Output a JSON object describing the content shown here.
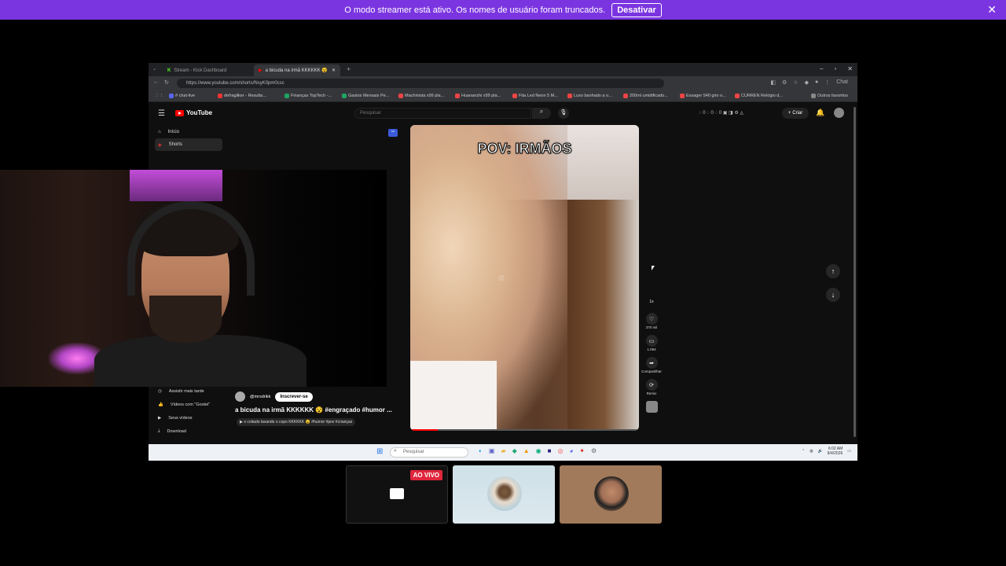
{
  "banner": {
    "message": "O modo streamer está ativo. Os nomes de usuário foram truncados.",
    "button_label": "Desativar",
    "bg_color": "#7b35e0"
  },
  "browser": {
    "tabs": [
      {
        "label": "Stream - Kick Dashboard"
      },
      {
        "label": "a bicuda na irmã KKKKKK 😵"
      }
    ],
    "url": "https://www.youtube.com/shorts/NsyK0pm0csc",
    "bookmarks": [
      "# chat-live",
      "defragliker - Resulta...",
      "Finanças TopTech -...",
      "Gastos Mensais Pe...",
      "Machinista x99 pla...",
      "Huananzhi x99 pla...",
      "Fita Led Neon 5 M...",
      "Luxo banhado a o...",
      "200ml umidificado...",
      "Essager 540 giro o...",
      "CURREN Relógio d...",
      "Outros favoritos"
    ],
    "chat_label": "Chat"
  },
  "youtube": {
    "logo_text": "YouTube",
    "search_placeholder": "Pesquisar",
    "create_label": "Criar",
    "sidebar_top": [
      {
        "icon": "home-icon",
        "label": "Início"
      },
      {
        "icon": "shorts-icon",
        "label": "Shorts"
      }
    ],
    "sidebar_bottom": [
      {
        "icon": "clock-icon",
        "label": "Assistir mais tarde"
      },
      {
        "icon": "like-icon",
        "label": "Vídeos com \"Gostei\""
      },
      {
        "icon": "video-icon",
        "label": "Seus vídeos"
      },
      {
        "icon": "download-icon",
        "label": "Download"
      }
    ],
    "short": {
      "caption": "POV: IRMÃOS",
      "channel": "@mrsdrikk",
      "subscribe_label": "Inscrever-se",
      "title": "a bicuda na irmã KKKKKK 😵 #engraçado #humor ...",
      "description": "▶ o coitado lavando o copo KKKKKK 😵 #humor #pov #crianças"
    },
    "actions": [
      {
        "icon": "speed-icon",
        "label": "1x"
      },
      {
        "icon": "heart-icon",
        "label": "370 mil"
      },
      {
        "icon": "comment-icon",
        "label": "1.094"
      },
      {
        "icon": "share-icon",
        "label": "Compartilhar"
      },
      {
        "icon": "remix-icon",
        "label": "Remix"
      }
    ]
  },
  "taskbar": {
    "search_placeholder": "Pesquisar",
    "time": "6:02 AM",
    "date": "8/4/2026"
  },
  "bottom_thumbs": {
    "live_label": "AO VIVO"
  }
}
